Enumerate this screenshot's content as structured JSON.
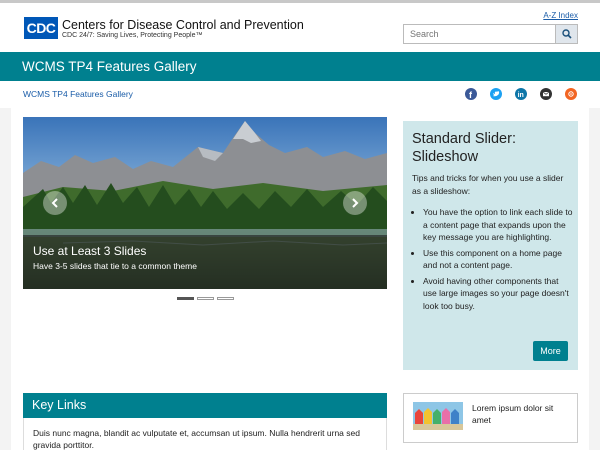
{
  "header": {
    "logo_text": "CDC",
    "org_title": "Centers for Disease Control and Prevention",
    "tagline": "CDC 24/7: Saving Lives, Protecting People™",
    "az_link": "A-Z Index",
    "search": {
      "placeholder": "Search",
      "icon": "search-icon"
    }
  },
  "banner": {
    "title": "WCMS TP4 Features Gallery"
  },
  "breadcrumb": {
    "label": "WCMS TP4 Features Gallery"
  },
  "social": [
    {
      "icon": "facebook-icon",
      "color": "#3b5998"
    },
    {
      "icon": "twitter-icon",
      "color": "#1da1f2"
    },
    {
      "icon": "linkedin-icon",
      "color": "#0e76a8"
    },
    {
      "icon": "email-icon",
      "color": "#333333"
    },
    {
      "icon": "syndicate-icon",
      "color": "#f26522"
    }
  ],
  "slider": {
    "caption_title": "Use at Least 3 Slides",
    "caption_subtitle": "Have 3-5 slides that tie to a common theme",
    "prev_icon": "chevron-left-icon",
    "next_icon": "chevron-right-icon",
    "slide_count": 3,
    "active_slide": 1
  },
  "aside": {
    "title": "Standard Slider: Slideshow",
    "intro": "Tips and tricks for when you use a slider as a slideshow:",
    "bullets": [
      "You have the option to link each slide to a content page that expands upon the key message you are highlighting.",
      "Use this component on a home page and not a content page.",
      "Avoid having other components that use large images so your page doesn't look too busy."
    ],
    "more_label": "More"
  },
  "key_links": {
    "title": "Key Links",
    "body": "Duis nunc magna, blandit ac vulputate et, accumsan ut ipsum. Nulla hendrerit urna sed gravida porttitor."
  },
  "card": {
    "text": "Lorem ipsum dolor sit amet"
  },
  "colors": {
    "teal": "#00808f",
    "aside_bg": "#cfe7ea",
    "link": "#1a5ca8",
    "logo_blue": "#0057b7"
  }
}
